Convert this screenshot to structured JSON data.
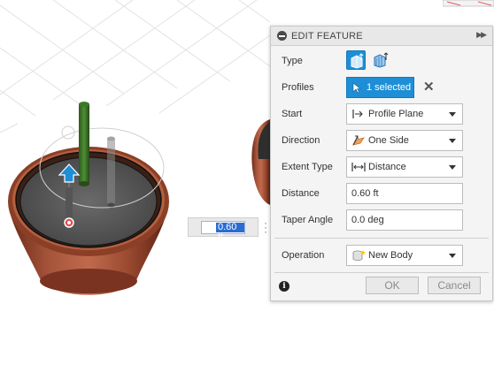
{
  "canvas": {
    "distance_input_value": "0.60 ft"
  },
  "panel": {
    "title": "EDIT FEATURE",
    "rows": {
      "type_label": "Type",
      "profiles_label": "Profiles",
      "profiles_value": "1 selected",
      "start_label": "Start",
      "start_value": "Profile Plane",
      "direction_label": "Direction",
      "direction_value": "One Side",
      "extent_label": "Extent Type",
      "extent_value": "Distance",
      "distance_label": "Distance",
      "distance_value": "0.60 ft",
      "taper_label": "Taper Angle",
      "taper_value": "0.0 deg",
      "operation_label": "Operation",
      "operation_value": "New Body"
    },
    "footer": {
      "ok_label": "OK",
      "cancel_label": "Cancel"
    },
    "icons": {
      "collapse": "minus-circle-icon",
      "expand": "double-chevron-right-icon",
      "type_solid": "solid-extrude-icon",
      "type_thin": "thin-extrude-icon",
      "profiles": "select-cursor-icon",
      "clear": "close-icon",
      "start": "profile-plane-icon",
      "direction": "one-side-icon",
      "extent": "distance-icon",
      "operation": "new-body-icon",
      "info": "info-icon"
    },
    "colors": {
      "accent": "#1e8fd6",
      "panel_bg": "#f4f4f4"
    }
  }
}
